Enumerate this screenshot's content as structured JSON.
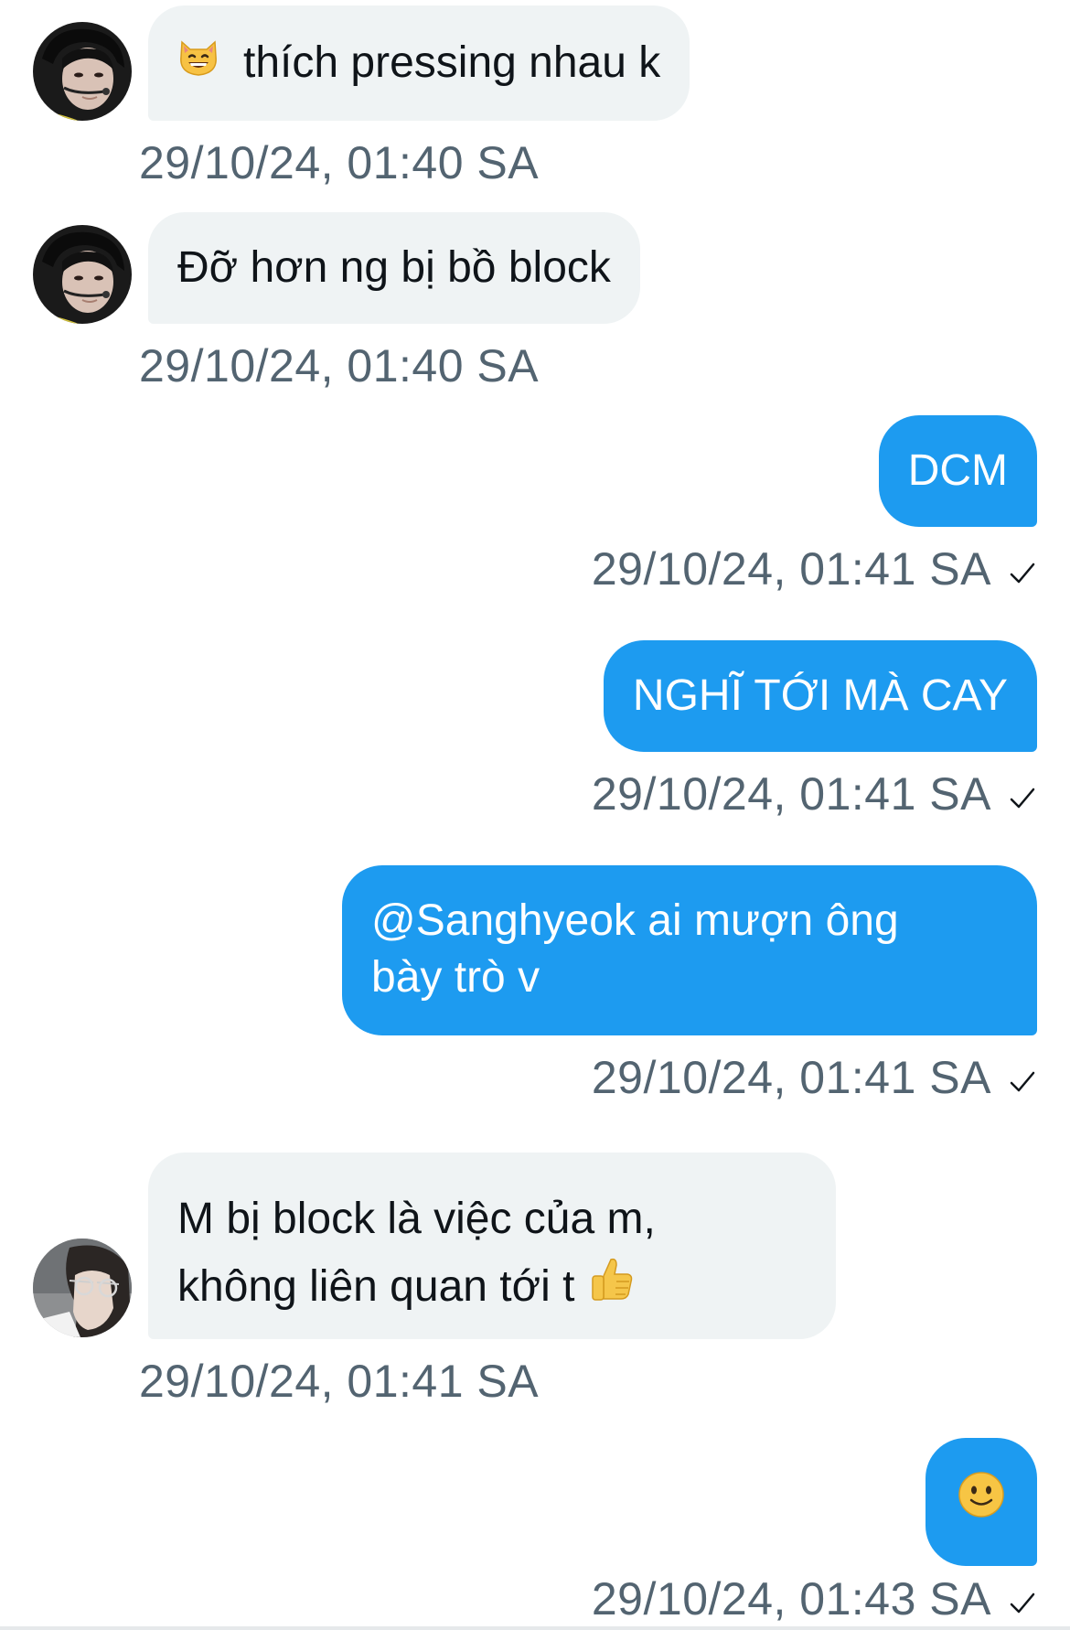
{
  "messages": [
    {
      "direction": "incoming",
      "avatar_icon": "user-avatar-icon",
      "emoji_icon": "grinning-cat-emoji-icon",
      "text": "thích pressing nhau k",
      "timestamp": "29/10/24, 01:40 SA"
    },
    {
      "direction": "incoming",
      "avatar_icon": "user-avatar-icon",
      "text": "Đỡ hơn ng bị bồ block",
      "timestamp": "29/10/24, 01:40 SA"
    },
    {
      "direction": "outgoing",
      "text": "DCM",
      "timestamp": "29/10/24, 01:41 SA",
      "status_icon": "checkmark-icon"
    },
    {
      "direction": "outgoing",
      "text": "NGHĨ TỚI MÀ CAY",
      "timestamp": "29/10/24, 01:41 SA",
      "status_icon": "checkmark-icon"
    },
    {
      "direction": "outgoing",
      "lines": [
        "@Sanghyeok ai mượn ông",
        "bày trò v"
      ],
      "timestamp": "29/10/24, 01:41 SA",
      "status_icon": "checkmark-icon"
    },
    {
      "direction": "incoming",
      "avatar_icon": "user-avatar-icon",
      "lines": [
        "M bị block là việc của m,",
        "không liên quan tới t"
      ],
      "emoji_icon": "thumbs-up-emoji-icon",
      "timestamp": "29/10/24, 01:41 SA"
    },
    {
      "direction": "outgoing",
      "emoji_icon": "slightly-smiling-face-emoji-icon",
      "timestamp": "29/10/24, 01:43 SA",
      "status_icon": "checkmark-icon"
    }
  ],
  "colors": {
    "outgoing_bubble": "#1d9bf0",
    "incoming_bubble": "#eff3f4",
    "timestamp_text": "#536471"
  }
}
